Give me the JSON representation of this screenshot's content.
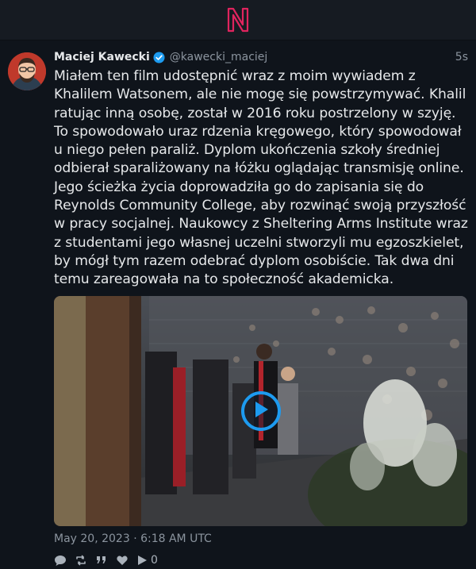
{
  "app": {
    "logo_icon": "nitter-logo",
    "accent": "#e0245e"
  },
  "tweet": {
    "author_name": "Maciej Kawecki",
    "author_handle": "@kawecki_maciej",
    "time_ago": "5s",
    "text": "Miałem ten film udostępnić wraz z moim wywiadem z Khalilem Watsonem, ale nie mogę się powstrzymywać. Khalil ratując inną osobę, został w 2016 roku postrzelony w szyję. To spowodowało uraz rdzenia kręgowego, który spowodował u niego pełen paraliż. Dyplom ukończenia szkoły średniej odbierał sparaliżowany na łóżku oglądając transmisję online. Jego ścieżka życia doprowadziła go do zapisania się do Reynolds Community College, aby rozwinąć swoją przyszłość w pracy socjalnej. Naukowcy z Sheltering Arms Institute wraz z studentami jego własnej uczelni stworzyli mu egzoszkielet, by mógł tym razem odebrać dyplom osobiście. Tak dwa dni temu zareagowała na to społeczność akademicka.",
    "date": "May 20, 2023 · 6:18 AM UTC",
    "video_play_icon": "play-icon",
    "play_color": "#1d9bf0",
    "stats": {
      "views": "0"
    }
  }
}
